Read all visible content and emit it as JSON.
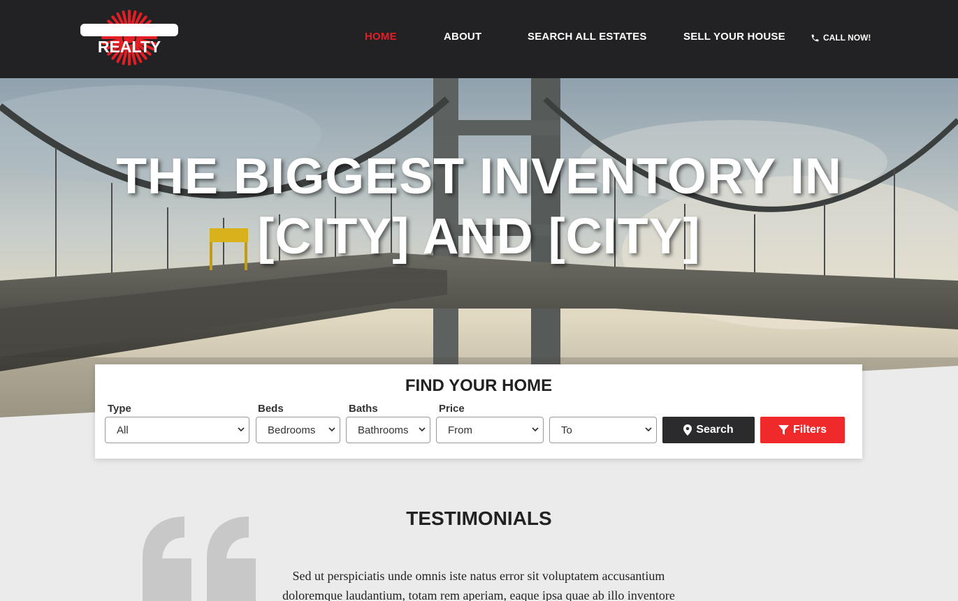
{
  "brand": {
    "logo_text": "REALTY"
  },
  "nav": {
    "items": [
      {
        "label": "HOME",
        "active": true
      },
      {
        "label": "ABOUT",
        "active": false
      },
      {
        "label": "SEARCH ALL ESTATES",
        "active": false
      },
      {
        "label": "SELL YOUR HOUSE",
        "active": false
      }
    ],
    "call_label": "CALL NOW!"
  },
  "hero": {
    "title_line1": "THE BIGGEST INVENTORY IN",
    "title_line2": "[CITY] AND [CITY]"
  },
  "search": {
    "title": "FIND YOUR HOME",
    "type_label": "Type",
    "type_value": "All",
    "beds_label": "Beds",
    "beds_value": "Bedrooms",
    "baths_label": "Baths",
    "baths_value": "Bathrooms",
    "price_label": "Price",
    "price_from": "From",
    "price_to": "To",
    "search_button": "Search",
    "filters_button": "Filters"
  },
  "testimonials": {
    "title": "TESTIMONIALS",
    "line1": "Sed ut perspiciatis unde omnis iste natus error sit voluptatem accusantium",
    "line2": "doloremque laudantium, totam rem aperiam, eaque ipsa quae ab illo inventore"
  },
  "colors": {
    "header_bg": "#222224",
    "accent_red": "#e31e24",
    "button_dark": "#2b2b2d",
    "button_red": "#f02a2a"
  },
  "icons": [
    "phone-icon",
    "map-marker-icon",
    "filter-icon",
    "quote-icon",
    "chevron-down-icon"
  ]
}
